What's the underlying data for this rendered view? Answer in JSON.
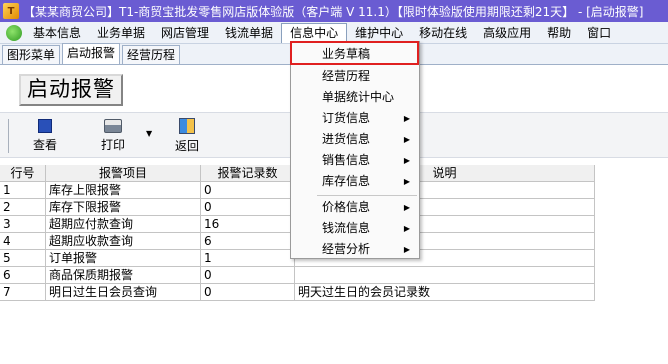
{
  "window": {
    "title": "【某某商贸公司】T1-商贸宝批发零售网店版体验版（客户端 V 11.1）【限时体验版使用期限还剩21天】 - [启动报警]"
  },
  "menubar": {
    "items": [
      "基本信息",
      "业务单据",
      "网店管理",
      "钱流单据",
      "信息中心",
      "维护中心",
      "移动在线",
      "高级应用",
      "帮助",
      "窗口"
    ]
  },
  "tabs": [
    "图形菜单",
    "启动报警",
    "经营历程"
  ],
  "page": {
    "heading": "启动报警"
  },
  "toolbar": {
    "view": "查看",
    "print": "打印",
    "back": "返回"
  },
  "table": {
    "headers": [
      "行号",
      "报警项目",
      "报警记录数",
      "说明"
    ],
    "rows": [
      [
        "1",
        "库存上限报警",
        "0",
        ""
      ],
      [
        "2",
        "库存下限报警",
        "0",
        ""
      ],
      [
        "3",
        "超期应付款查询",
        "16",
        ""
      ],
      [
        "4",
        "超期应收款查询",
        "6",
        ""
      ],
      [
        "5",
        "订单报警",
        "1",
        ""
      ],
      [
        "6",
        "商品保质期报警",
        "0",
        ""
      ],
      [
        "7",
        "明日过生日会员查询",
        "0",
        "明天过生日的会员记录数"
      ]
    ]
  },
  "dropdown": {
    "items": [
      {
        "label": "业务草稿",
        "submenu": false
      },
      {
        "label": "经营历程",
        "submenu": false
      },
      {
        "label": "单据统计中心",
        "submenu": false
      },
      {
        "label": "订货信息",
        "submenu": true
      },
      {
        "label": "进货信息",
        "submenu": true
      },
      {
        "label": "销售信息",
        "submenu": true
      },
      {
        "label": "库存信息",
        "submenu": true
      },
      {
        "label": "价格信息",
        "submenu": true
      },
      {
        "label": "钱流信息",
        "submenu": true
      },
      {
        "label": "经营分析",
        "submenu": true
      }
    ]
  },
  "colors": {
    "titlebar": "#6a5cd2",
    "highlight_border": "#e02020"
  }
}
